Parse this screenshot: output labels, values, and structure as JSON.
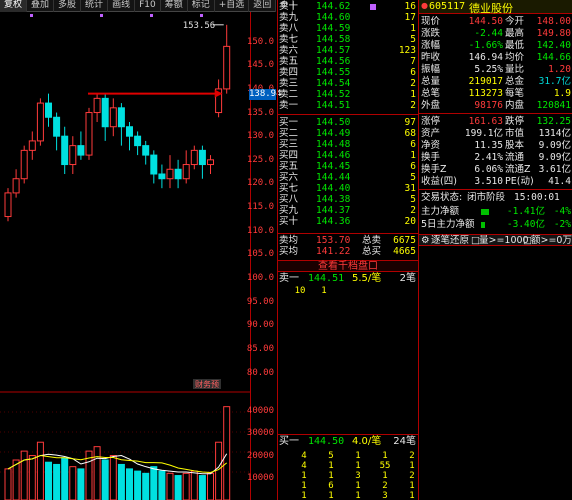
{
  "tabs": [
    "复权",
    "叠加",
    "多股",
    "统计",
    "画线",
    "F10",
    "筹额",
    "标记",
    "+自选",
    "返回"
  ],
  "chart": {
    "price_ticks": [
      "150.0",
      "145.0",
      "140.0",
      "135.0",
      "130.0",
      "125.0",
      "120.0",
      "115.0",
      "110.0",
      "105.0",
      "100.0",
      "95.00",
      "90.00",
      "85.00",
      "80.00"
    ],
    "current_price": "138.94",
    "high_label": "153.56",
    "volume_ticks": [
      "40000",
      "30000",
      "20000",
      "10000"
    ],
    "indicator_label": "财务",
    "indicator_label2": "预"
  },
  "chart_data": {
    "type": "candlestick",
    "candles": [
      {
        "o": 113,
        "c": 118,
        "h": 119,
        "l": 112,
        "up": true
      },
      {
        "o": 118,
        "c": 121,
        "h": 123,
        "l": 117,
        "up": true
      },
      {
        "o": 121,
        "c": 127,
        "h": 128,
        "l": 120,
        "up": true
      },
      {
        "o": 127,
        "c": 129,
        "h": 131,
        "l": 125,
        "up": true
      },
      {
        "o": 129,
        "c": 137,
        "h": 138,
        "l": 128,
        "up": true
      },
      {
        "o": 137,
        "c": 134,
        "h": 139,
        "l": 132,
        "up": false
      },
      {
        "o": 134,
        "c": 130,
        "h": 135,
        "l": 127,
        "up": false
      },
      {
        "o": 130,
        "c": 124,
        "h": 132,
        "l": 122,
        "up": false
      },
      {
        "o": 124,
        "c": 128,
        "h": 130,
        "l": 122,
        "up": true
      },
      {
        "o": 128,
        "c": 126,
        "h": 131,
        "l": 125,
        "up": false
      },
      {
        "o": 126,
        "c": 135,
        "h": 136,
        "l": 125,
        "up": true
      },
      {
        "o": 135,
        "c": 138,
        "h": 139,
        "l": 133,
        "up": true
      },
      {
        "o": 138,
        "c": 132,
        "h": 139,
        "l": 129,
        "up": false
      },
      {
        "o": 132,
        "c": 136,
        "h": 138,
        "l": 130,
        "up": true
      },
      {
        "o": 136,
        "c": 132,
        "h": 137,
        "l": 128,
        "up": false
      },
      {
        "o": 132,
        "c": 130,
        "h": 133,
        "l": 127,
        "up": false
      },
      {
        "o": 130,
        "c": 128,
        "h": 131,
        "l": 126,
        "up": false
      },
      {
        "o": 128,
        "c": 126,
        "h": 129,
        "l": 124,
        "up": false
      },
      {
        "o": 126,
        "c": 122,
        "h": 127,
        "l": 120,
        "up": false
      },
      {
        "o": 122,
        "c": 121,
        "h": 124,
        "l": 119,
        "up": false
      },
      {
        "o": 121,
        "c": 123,
        "h": 126,
        "l": 119,
        "up": true
      },
      {
        "o": 123,
        "c": 121,
        "h": 125,
        "l": 119,
        "up": false
      },
      {
        "o": 121,
        "c": 124,
        "h": 127,
        "l": 120,
        "up": true
      },
      {
        "o": 124,
        "c": 127,
        "h": 128,
        "l": 123,
        "up": true
      },
      {
        "o": 127,
        "c": 124,
        "h": 128,
        "l": 121,
        "up": false
      },
      {
        "o": 124,
        "c": 125,
        "h": 126,
        "l": 122,
        "up": true
      },
      {
        "o": 135,
        "c": 140,
        "h": 142,
        "l": 134,
        "up": true
      },
      {
        "o": 140,
        "c": 149,
        "h": 153.56,
        "l": 139,
        "up": true
      }
    ],
    "volume": [
      14000,
      18000,
      22000,
      20000,
      26000,
      17000,
      16000,
      19000,
      15000,
      14000,
      22000,
      24000,
      18000,
      20000,
      16000,
      14000,
      13000,
      12000,
      15000,
      13000,
      12000,
      11000,
      12000,
      13000,
      11000,
      12000,
      26000,
      42000
    ],
    "price_range": [
      78,
      155
    ],
    "volume_range": [
      0,
      45000
    ]
  },
  "book": {
    "sells": [
      {
        "label": "卖十",
        "price": "144.62",
        "vol": "16",
        "mark": true
      },
      {
        "label": "卖九",
        "price": "144.60",
        "vol": "17"
      },
      {
        "label": "卖八",
        "price": "144.59",
        "vol": "1"
      },
      {
        "label": "卖七",
        "price": "144.58",
        "vol": "5"
      },
      {
        "label": "卖六",
        "price": "144.57",
        "vol": "123"
      },
      {
        "label": "卖五",
        "price": "144.56",
        "vol": "7"
      },
      {
        "label": "卖四",
        "price": "144.55",
        "vol": "6"
      },
      {
        "label": "卖三",
        "price": "144.54",
        "vol": "2"
      },
      {
        "label": "卖二",
        "price": "144.52",
        "vol": "1"
      },
      {
        "label": "卖一",
        "price": "144.51",
        "vol": "2"
      }
    ],
    "buys": [
      {
        "label": "买一",
        "price": "144.50",
        "vol": "97"
      },
      {
        "label": "买二",
        "price": "144.49",
        "vol": "68"
      },
      {
        "label": "买三",
        "price": "144.48",
        "vol": "6"
      },
      {
        "label": "买四",
        "price": "144.46",
        "vol": "1"
      },
      {
        "label": "买五",
        "price": "144.45",
        "vol": "6"
      },
      {
        "label": "买六",
        "price": "144.44",
        "vol": "5"
      },
      {
        "label": "买七",
        "price": "144.40",
        "vol": "31"
      },
      {
        "label": "买八",
        "price": "144.38",
        "vol": "5"
      },
      {
        "label": "买九",
        "price": "144.37",
        "vol": "2"
      },
      {
        "label": "买十",
        "price": "144.36",
        "vol": "20"
      }
    ],
    "avg_sell_label": "卖均",
    "avg_sell": "153.70",
    "total_sell_label": "总卖",
    "total_sell": "6675",
    "avg_buy_label": "买均",
    "avg_buy": "141.22",
    "total_buy_label": "总买",
    "total_buy": "4665",
    "board_button": "查看千档盘口",
    "sell1_detail": {
      "label": "卖一",
      "price": "144.51",
      "avg": "5.5/笔",
      "count": "2笔"
    },
    "sell1_queue": [
      "10",
      "1"
    ],
    "buy1_detail": {
      "label": "买一",
      "price": "144.50",
      "avg": "4.0/笔",
      "count": "24笔"
    },
    "buy1_queue": [
      [
        "4",
        "5",
        "1",
        "1",
        "2"
      ],
      [
        "4",
        "1",
        "1",
        "55",
        "1"
      ],
      [
        "1",
        "1",
        "3",
        "1",
        "2"
      ],
      [
        "1",
        "6",
        "1",
        "2",
        "1"
      ],
      [
        "1",
        "1",
        "1",
        "3",
        "1"
      ]
    ]
  },
  "stats": {
    "code": "605117",
    "name": "德业股份",
    "rows": [
      {
        "l1": "现价",
        "v1": "144.50",
        "l2": "今开",
        "v2": "148.00",
        "c1": "red",
        "c2": "red"
      },
      {
        "l1": "涨跌",
        "v1": "-2.44",
        "l2": "最高",
        "v2": "149.80",
        "c1": "green",
        "c2": "red"
      },
      {
        "l1": "涨幅",
        "v1": "-1.66%",
        "l2": "最低",
        "v2": "142.40",
        "c1": "green",
        "c2": "green"
      },
      {
        "l1": "昨收",
        "v1": "146.94",
        "l2": "均价",
        "v2": "144.66",
        "c1": "white",
        "c2": "green"
      },
      {
        "l1": "振幅",
        "v1": "5.25%",
        "l2": "量比",
        "v2": "1.20",
        "c1": "white",
        "c2": "red"
      },
      {
        "l1": "总量",
        "v1": "219017",
        "l2": "总金",
        "v2": "31.7亿",
        "c1": "yellow",
        "c2": "cyan"
      },
      {
        "l1": "总笔",
        "v1": "113273",
        "l2": "每笔",
        "v2": "1.9",
        "c1": "yellow",
        "c2": "yellow"
      },
      {
        "l1": "外盘",
        "v1": "98176",
        "l2": "内盘",
        "v2": "120841",
        "c1": "red",
        "c2": "green"
      }
    ],
    "rows2": [
      {
        "l1": "涨停",
        "v1": "161.63",
        "l2": "跌停",
        "v2": "132.25",
        "c1": "red",
        "c2": "green"
      },
      {
        "l1": "资产",
        "v1": "199.1亿",
        "l2": "市值",
        "v2": "1314亿",
        "c1": "white",
        "c2": "white"
      },
      {
        "l1": "净资",
        "v1": "11.35",
        "l2": "股本",
        "v2": "9.09亿",
        "c1": "white",
        "c2": "white"
      },
      {
        "l1": "换手",
        "v1": "2.41%",
        "l2": "流通",
        "v2": "9.09亿",
        "c1": "white",
        "c2": "white"
      },
      {
        "l1": "换手Z",
        "v1": "6.06%",
        "l2": "流通Z",
        "v2": "3.61亿",
        "c1": "white",
        "c2": "white"
      },
      {
        "l1": "收益(四)",
        "v1": "3.510",
        "l2": "PE(动)",
        "v2": "41.4",
        "c1": "white",
        "c2": "white"
      }
    ],
    "trade_status_label": "交易状态:",
    "trade_status": "闭市阶段",
    "trade_time": "15:00:01",
    "flow1_label": "主力净额",
    "flow1_value": "-1.41亿",
    "flow1_pct": "-4%",
    "flow1_frac": 0.4,
    "flow2_label": "5日主力净额",
    "flow2_value": "-3.40亿",
    "flow2_pct": "-2%",
    "flow2_frac": 0.2,
    "detail_bar": {
      "title": "逐笔还原",
      "filter1": "量>=1000",
      "filter2": "额>=0万"
    }
  }
}
